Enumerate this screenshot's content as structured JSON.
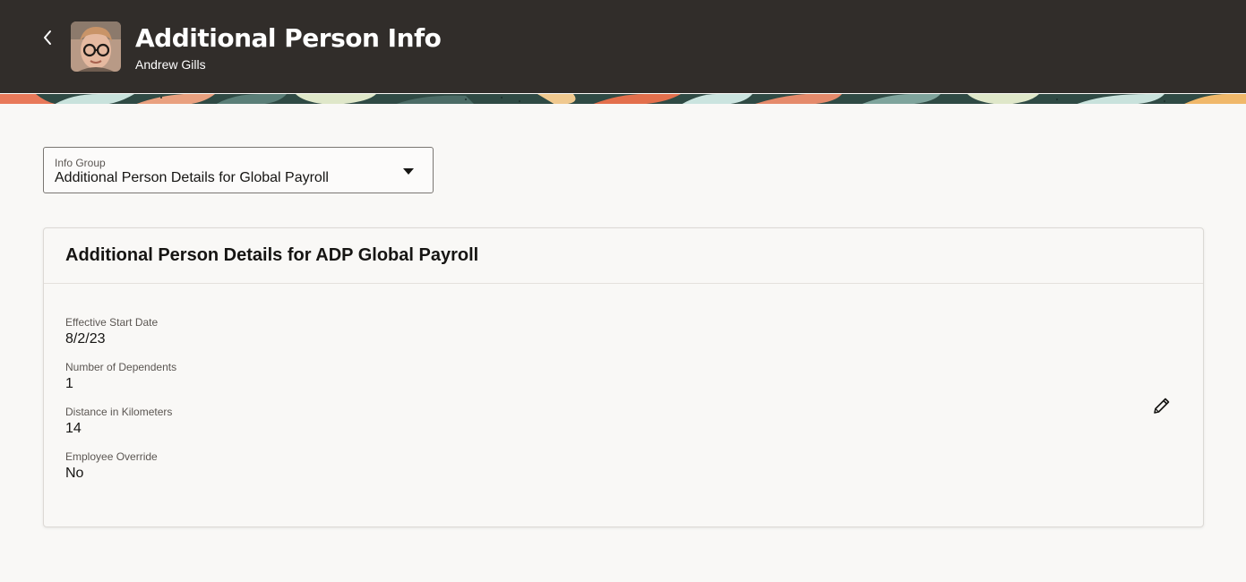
{
  "header": {
    "title": "Additional Person Info",
    "subtitle": "Andrew Gills",
    "back_icon": "chevron-left-icon",
    "bg_color": "#312d2a"
  },
  "info_group": {
    "label": "Info Group",
    "value": "Additional Person Details for Global Payroll",
    "caret_icon": "caret-down-icon"
  },
  "card": {
    "title": "Additional Person Details for ADP Global Payroll",
    "edit_icon": "pencil-icon",
    "fields": [
      {
        "label": "Effective Start Date",
        "value": "8/2/23"
      },
      {
        "label": "Number of Dependents",
        "value": "1"
      },
      {
        "label": "Distance in Kilometers",
        "value": "14"
      },
      {
        "label": "Employee Override",
        "value": "No"
      }
    ]
  }
}
